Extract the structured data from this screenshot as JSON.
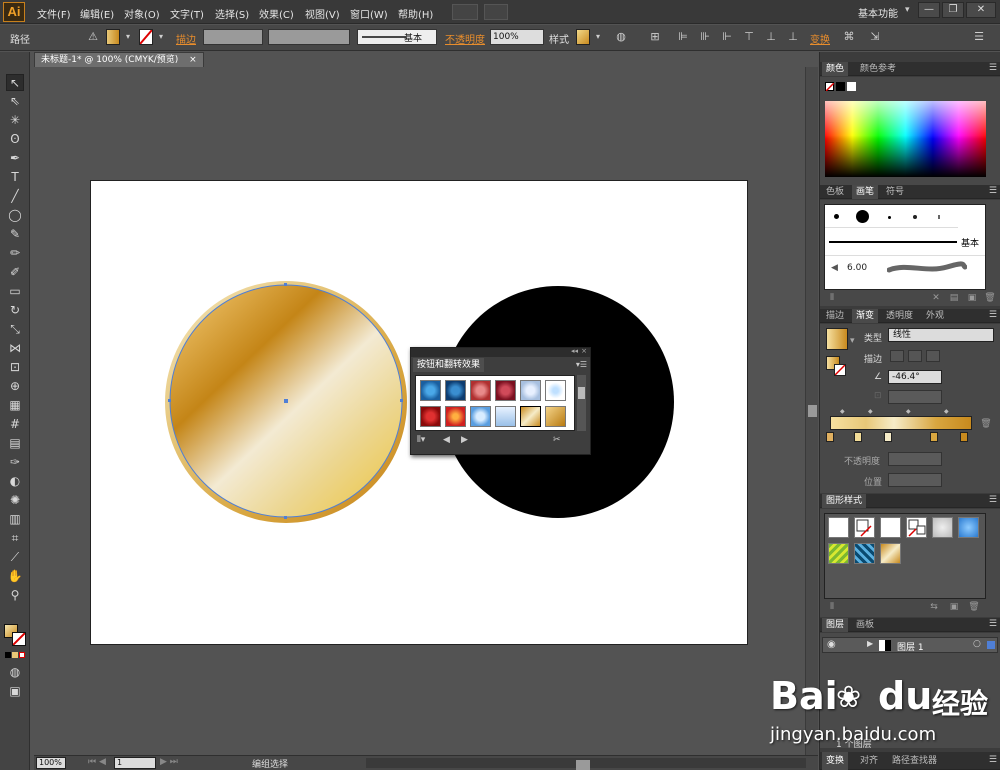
{
  "app": {
    "logo": "Ai"
  },
  "menu": [
    "文件(F)",
    "编辑(E)",
    "对象(O)",
    "文字(T)",
    "选择(S)",
    "效果(C)",
    "视图(V)",
    "窗口(W)",
    "帮助(H)"
  ],
  "workspace": "基本功能",
  "control": {
    "selection": "路径",
    "stroke_label": "描边",
    "stroke_profile": "基本",
    "opacity_label": "不透明度",
    "opacity_value": "100%",
    "style_label": "样式",
    "transform_label": "变换"
  },
  "document": {
    "tab_title": "未标题-1* @ 100% (CMYK/预览)"
  },
  "status": {
    "zoom": "100%",
    "artboard": "1",
    "info": "编组选择"
  },
  "panels": {
    "swatches": {
      "tabs": [
        "颜色",
        "颜色参考"
      ]
    },
    "brushes": {
      "tabs": [
        "色板",
        "画笔",
        "符号"
      ],
      "basic_label": "基本",
      "size_value": "6.00"
    },
    "gradient": {
      "tabs": [
        "描边",
        "渐变",
        "透明度",
        "外观"
      ],
      "type_label": "类型",
      "type_value": "线性",
      "stroke_label": "描边",
      "angle_value": "-46.4°",
      "opacity_label": "不透明度",
      "position_label": "位置"
    },
    "graphic_styles": {
      "title": "图形样式"
    },
    "layers": {
      "tabs": [
        "图层",
        "画板"
      ],
      "layer_name": "图层 1",
      "count": "1 个图层"
    },
    "bottom": {
      "tabs": [
        "变换",
        "对齐",
        "路径查找器"
      ]
    }
  },
  "floating_panel": {
    "title": "按钮和翻转效果"
  },
  "colors": {
    "gold_dark": "#c88a1e",
    "gold_light": "#f6ecc8",
    "accent_orange": "#e88d2c",
    "selection_blue": "#4f7fd6"
  },
  "watermark": {
    "brand": "Bai",
    "brand2": "du",
    "product": "经验",
    "url": "jingyan.baidu.com"
  }
}
